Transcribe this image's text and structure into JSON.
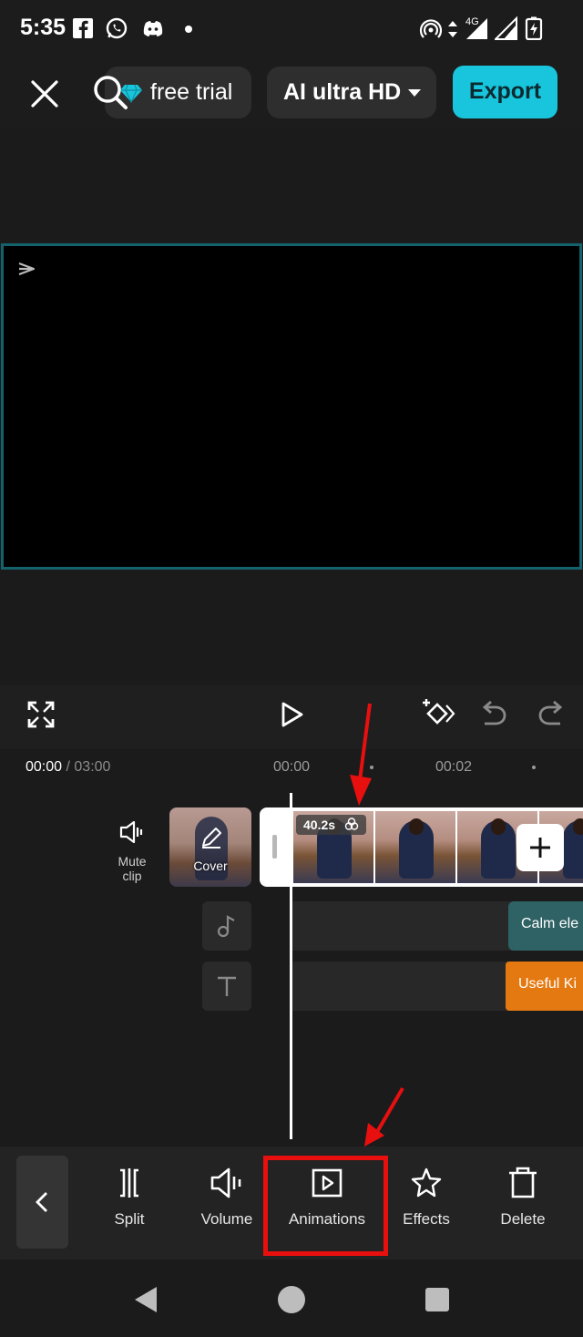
{
  "status_bar": {
    "time": "5:35",
    "network": "4G",
    "icons": [
      "facebook-icon",
      "whatsapp-icon",
      "discord-icon",
      "dot-icon",
      "hotspot-icon",
      "data-arrows-icon",
      "signal-icon",
      "signal-icon",
      "battery-charging-icon"
    ]
  },
  "header": {
    "close_icon": "close-icon",
    "trial_label": "free trial",
    "trial_icon": "diamond-icon",
    "quality_label": "AI ultra HD",
    "export_label": "Export"
  },
  "colors": {
    "accent": "#19c5dc",
    "preview_border": "#14626c",
    "audio_track": "#2f6265",
    "text_track": "#e57911",
    "annotation": "#e80f0f"
  },
  "playback": {
    "icons": [
      "fullscreen-icon",
      "play-icon",
      "keyframe-icon",
      "undo-icon",
      "redo-icon"
    ]
  },
  "timeline": {
    "current_time": "00:00",
    "total_time": "/ 03:00",
    "ruler_labels": [
      "00:00",
      "00:02"
    ],
    "mute_label_line1": "Mute",
    "mute_label_line2": "clip",
    "cover_label": "Cover",
    "clip_duration": "40.2s",
    "audio_clip_label": "Calm ele",
    "text_clip_label": "Useful Ki"
  },
  "toolbar": {
    "items": [
      {
        "label": "Split",
        "icon": "split-icon"
      },
      {
        "label": "Volume",
        "icon": "volume-icon"
      },
      {
        "label": "Animations",
        "icon": "animations-icon"
      },
      {
        "label": "Effects",
        "icon": "effects-icon"
      },
      {
        "label": "Delete",
        "icon": "delete-icon"
      }
    ],
    "highlighted": "Animations"
  }
}
